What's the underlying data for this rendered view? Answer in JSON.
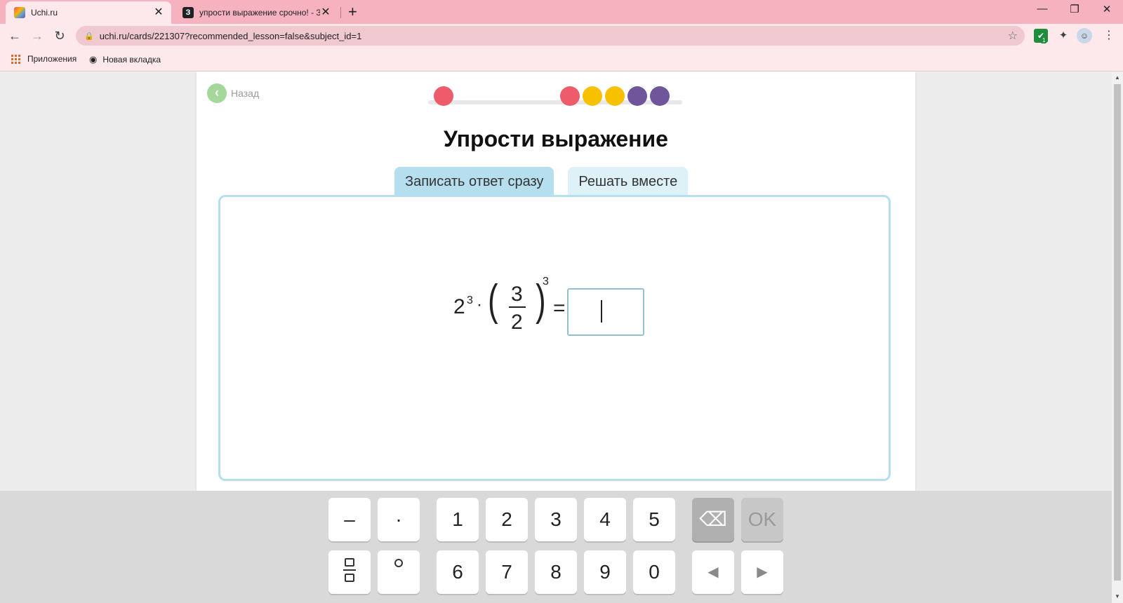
{
  "browser": {
    "tabs": [
      {
        "title": "Uchi.ru",
        "active": true
      },
      {
        "title": "упрости выражение срочно! - Зн",
        "active": false
      }
    ],
    "new_tab_glyph": "+",
    "close_glyph": "✕",
    "window_controls": {
      "minimize": "—",
      "restore": "❐",
      "close": "✕"
    },
    "url": "uchi.ru/cards/221307?recommended_lesson=false&subject_id=1",
    "extension_badge": "1",
    "bookmarks": [
      {
        "label": "Приложения",
        "icon": "apps-icon"
      },
      {
        "label": "Новая вкладка",
        "icon": "globe-icon"
      }
    ]
  },
  "card": {
    "back_label": "Назад",
    "progress_dots": [
      {
        "color": "#ee5b6a"
      },
      {
        "color": "#ee5b6a"
      },
      {
        "color": "#f7c100"
      },
      {
        "color": "#f7c100"
      },
      {
        "color": "#6f559a"
      },
      {
        "color": "#6f559a"
      }
    ],
    "title": "Упрости выражение",
    "mode_tabs": [
      {
        "label": "Записать ответ сразу",
        "selected": true
      },
      {
        "label": "Решать вместе",
        "selected": false
      }
    ],
    "expression": {
      "base": "2",
      "base_exp": "3",
      "dot": "·",
      "open_paren": "(",
      "numerator": "3",
      "denominator": "2",
      "close_paren": ")",
      "outer_exp": "3",
      "equals": "="
    },
    "answer_value": ""
  },
  "keyboard": {
    "row1": [
      "–",
      "·",
      "1",
      "2",
      "3",
      "4",
      "5"
    ],
    "row2": [
      "6",
      "7",
      "8",
      "9",
      "0"
    ],
    "ok_label": "OK",
    "backspace_icon": "⌫",
    "left_arrow": "◀",
    "right_arrow": "▶"
  }
}
